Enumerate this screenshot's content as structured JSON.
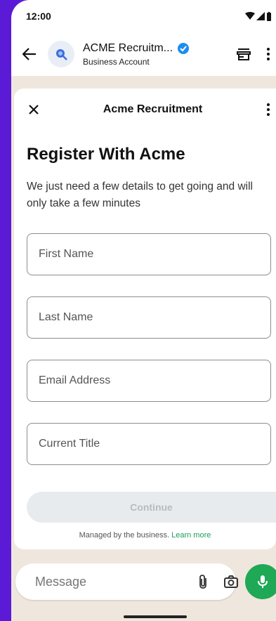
{
  "status": {
    "time": "12:00"
  },
  "chat_header": {
    "name": "ACME Recruitm...",
    "subtitle": "Business Account"
  },
  "sheet": {
    "title": "Acme Recruitment",
    "heading": "Register With Acme",
    "description": "We just need a few details to get going and will only take a few minutes",
    "fields": [
      {
        "placeholder": "First Name"
      },
      {
        "placeholder": "Last Name"
      },
      {
        "placeholder": "Email Address"
      },
      {
        "placeholder": "Current Title"
      }
    ],
    "continue_label": "Continue",
    "managed_text": "Managed by the business.",
    "learn_more": "Learn more"
  },
  "composer": {
    "placeholder": "Message"
  },
  "colors": {
    "background": "#5b1bd6",
    "accent_green": "#1fa855",
    "verified_blue": "#1d8df0"
  }
}
